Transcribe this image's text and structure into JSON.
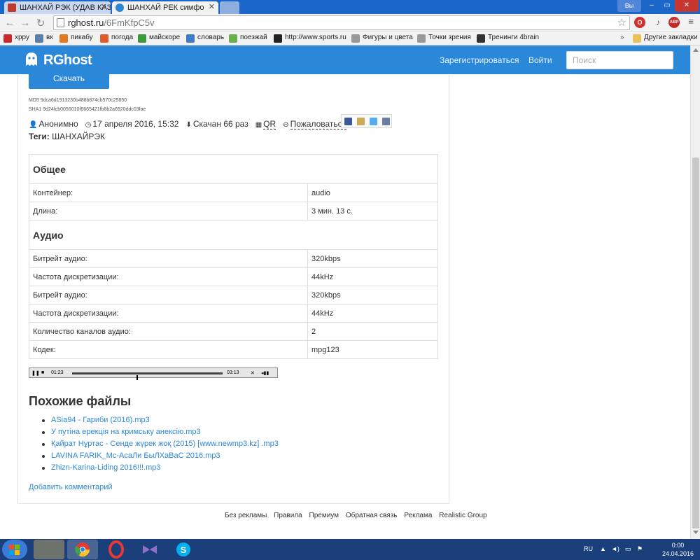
{
  "browser": {
    "tabs": [
      {
        "title": "ШАНХАЙ РЭК (УДАВ КАЗ"
      },
      {
        "title": "ШАНХАЙ РЕК симфо"
      }
    ],
    "profile_label": "Вы",
    "url_host": "rghost.ru",
    "url_path": "/6FmKfpC5v",
    "ext_badges": {
      "opera": "O",
      "adblock": "ABP"
    },
    "bookmarks": [
      {
        "label": "хрру",
        "color": "#cc2a2a"
      },
      {
        "label": "вк",
        "color": "#5b7fa6"
      },
      {
        "label": "пикабу",
        "color": "#e07a1f"
      },
      {
        "label": "погода",
        "color": "#e35b2a"
      },
      {
        "label": "майскоре",
        "color": "#3a9a3a"
      },
      {
        "label": "словарь",
        "color": "#3c7bc8"
      },
      {
        "label": "поезжай",
        "color": "#6ab04c"
      },
      {
        "label": "http://www.sports.ru",
        "color": "#222222"
      },
      {
        "label": "Фигуры и цвета",
        "color": "#999999"
      },
      {
        "label": "Точки зрения",
        "color": "#999999"
      },
      {
        "label": "Тренинги 4brain",
        "color": "#333333"
      }
    ],
    "other_bookmarks": "Другие закладки",
    "overflow": "»"
  },
  "header": {
    "logo_text": "RGhost",
    "register": "Зарегистрироваться",
    "login": "Войти",
    "search_placeholder": "Поиск"
  },
  "file": {
    "download_label": "Скачать",
    "md5": "MD5  9dca6d1913230b488b874cb570c25850",
    "sha1": "SHA1 9d24fcb0056010f6665421fb8b2a6920ddc03fae",
    "author": "Анонимно",
    "date": "17 апреля 2016, 15:32",
    "downloads": "Скачан 66 раз",
    "qr": "QR",
    "report": "Пожаловаться",
    "tags_label": "Теги:",
    "tags_value": "ШАНХАЙРЭК"
  },
  "info": {
    "general_title": "Общее",
    "general_rows": [
      {
        "key": "Контейнер:",
        "value": "audio"
      },
      {
        "key": "Длина:",
        "value": "3 мин. 13 с."
      }
    ],
    "audio_title": "Аудио",
    "audio_rows": [
      {
        "key": "Битрейт аудио:",
        "value": "320kbps"
      },
      {
        "key": "Частота дискретизации:",
        "value": "44kHz"
      },
      {
        "key": "Битрейт аудио:",
        "value": "320kbps"
      },
      {
        "key": "Частота дискретизации:",
        "value": "44kHz"
      },
      {
        "key": "Количество каналов аудио:",
        "value": "2"
      },
      {
        "key": "Кодек:",
        "value": "mpg123"
      }
    ]
  },
  "player": {
    "current_time": "01:23",
    "total_time": "03:13",
    "progress": 0.43
  },
  "similar": {
    "title": "Похожие файлы",
    "items": [
      "ASia94 - Гариби (2016).mp3",
      "У путіна ерекція на кримську анексію.mp3",
      "Қайрат Нұртас - Сенде жүрек жоқ (2015) [www.newmp3.kz] .mp3",
      "LAVINA FARIK_Mc-АсаЛи БыЛХаВаС 2016.mp3",
      "Zhizn-Karina-Liding 2016!!!.mp3"
    ]
  },
  "add_comment": "Добавить комментарий",
  "footer": [
    "Без рекламы",
    "Правила",
    "Премиум",
    "Обратная связь",
    "Реклама",
    "Realistic Group"
  ],
  "taskbar": {
    "lang": "RU",
    "time": "0:00",
    "date": "24.04.2016"
  },
  "colors": {
    "accent": "#2b88d9",
    "link": "#2b88d9",
    "taskbar": "#1b3f7a"
  }
}
